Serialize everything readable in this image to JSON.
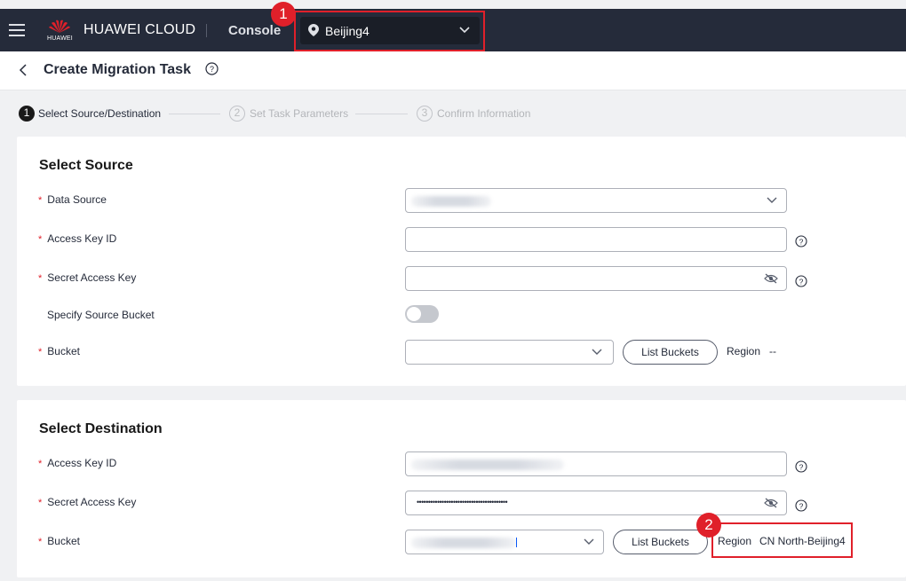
{
  "header": {
    "brand": "HUAWEI CLOUD",
    "logo_text": "HUAWEI",
    "console": "Console",
    "region": "Beijing4"
  },
  "title_bar": {
    "title": "Create Migration Task"
  },
  "steps": [
    {
      "num": "1",
      "label": "Select Source/Destination",
      "active": true
    },
    {
      "num": "2",
      "label": "Set Task Parameters",
      "active": false
    },
    {
      "num": "3",
      "label": "Confirm Information",
      "active": false
    }
  ],
  "annotations": {
    "badge1": "1",
    "badge2": "2",
    "color": "#e0202a"
  },
  "source": {
    "title": "Select Source",
    "data_source_label": "Data Source",
    "access_key_label": "Access Key ID",
    "access_key_value": "",
    "secret_key_label": "Secret Access Key",
    "secret_key_value": "",
    "specify_bucket_label": "Specify Source Bucket",
    "specify_bucket_on": false,
    "bucket_label": "Bucket",
    "bucket_value": "",
    "list_buckets": "List Buckets",
    "region_label": "Region",
    "region_value": "--"
  },
  "destination": {
    "title": "Select Destination",
    "access_key_label": "Access Key ID",
    "secret_key_label": "Secret Access Key",
    "secret_key_value": "••••••••••••••••••••••••••••••••••••••••",
    "bucket_label": "Bucket",
    "list_buckets": "List Buckets",
    "region_label": "Region",
    "region_value": "CN North-Beijing4"
  },
  "colors": {
    "topbar": "#252b3a",
    "accent_red": "#e0202a",
    "page_bg": "#f0f1f3"
  }
}
